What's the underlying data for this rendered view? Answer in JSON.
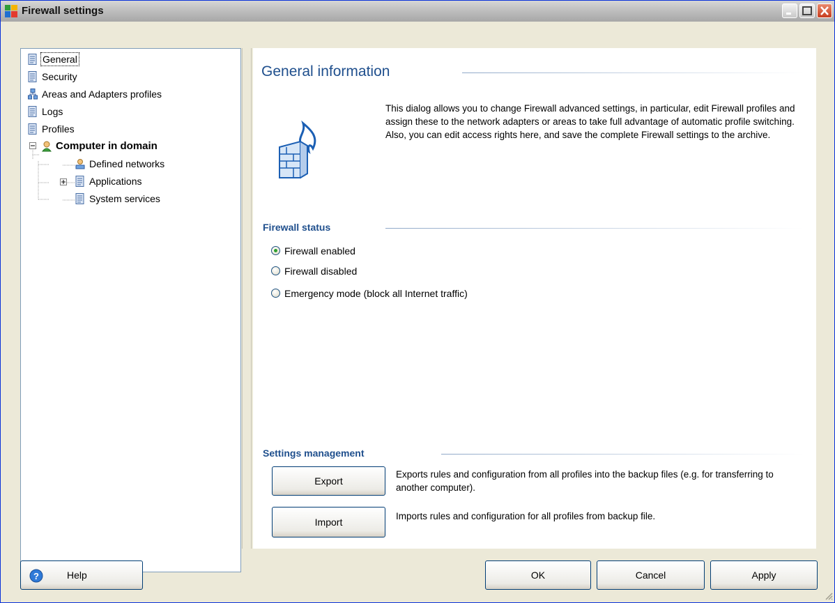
{
  "window": {
    "title": "Firewall settings"
  },
  "tree": {
    "items": [
      {
        "label": "General"
      },
      {
        "label": "Security"
      },
      {
        "label": "Areas and Adapters profiles"
      },
      {
        "label": "Logs"
      },
      {
        "label": "Profiles"
      },
      {
        "label": "Computer in domain"
      },
      {
        "label": "Defined networks"
      },
      {
        "label": "Applications"
      },
      {
        "label": "System services"
      }
    ]
  },
  "main": {
    "heading": "General information",
    "intro": "This dialog allows you to change Firewall advanced settings, in particular, edit Firewall profiles and assign these to the network adapters or areas to take full advantage of automatic profile switching. Also, you can edit access rights here, and save the complete Firewall settings to the archive.",
    "firewall_status": {
      "title": "Firewall status",
      "options": [
        {
          "label": "Firewall enabled",
          "checked": true
        },
        {
          "label": "Firewall disabled",
          "checked": false
        },
        {
          "label": "Emergency mode (block all Internet traffic)",
          "checked": false
        }
      ]
    },
    "settings_management": {
      "title": "Settings management",
      "export_label": "Export",
      "export_desc": "Exports rules and configuration from all profiles into the backup files (e.g. for transferring to another computer).",
      "import_label": "Import",
      "import_desc": "Imports rules and configuration for all profiles from backup file."
    }
  },
  "footer": {
    "help_label": "Help",
    "ok_label": "OK",
    "cancel_label": "Cancel",
    "apply_label": "Apply"
  },
  "colors": {
    "heading": "#1f4f8d",
    "title_bar": "#bdbdbd",
    "close_button": "#c73d1f"
  }
}
